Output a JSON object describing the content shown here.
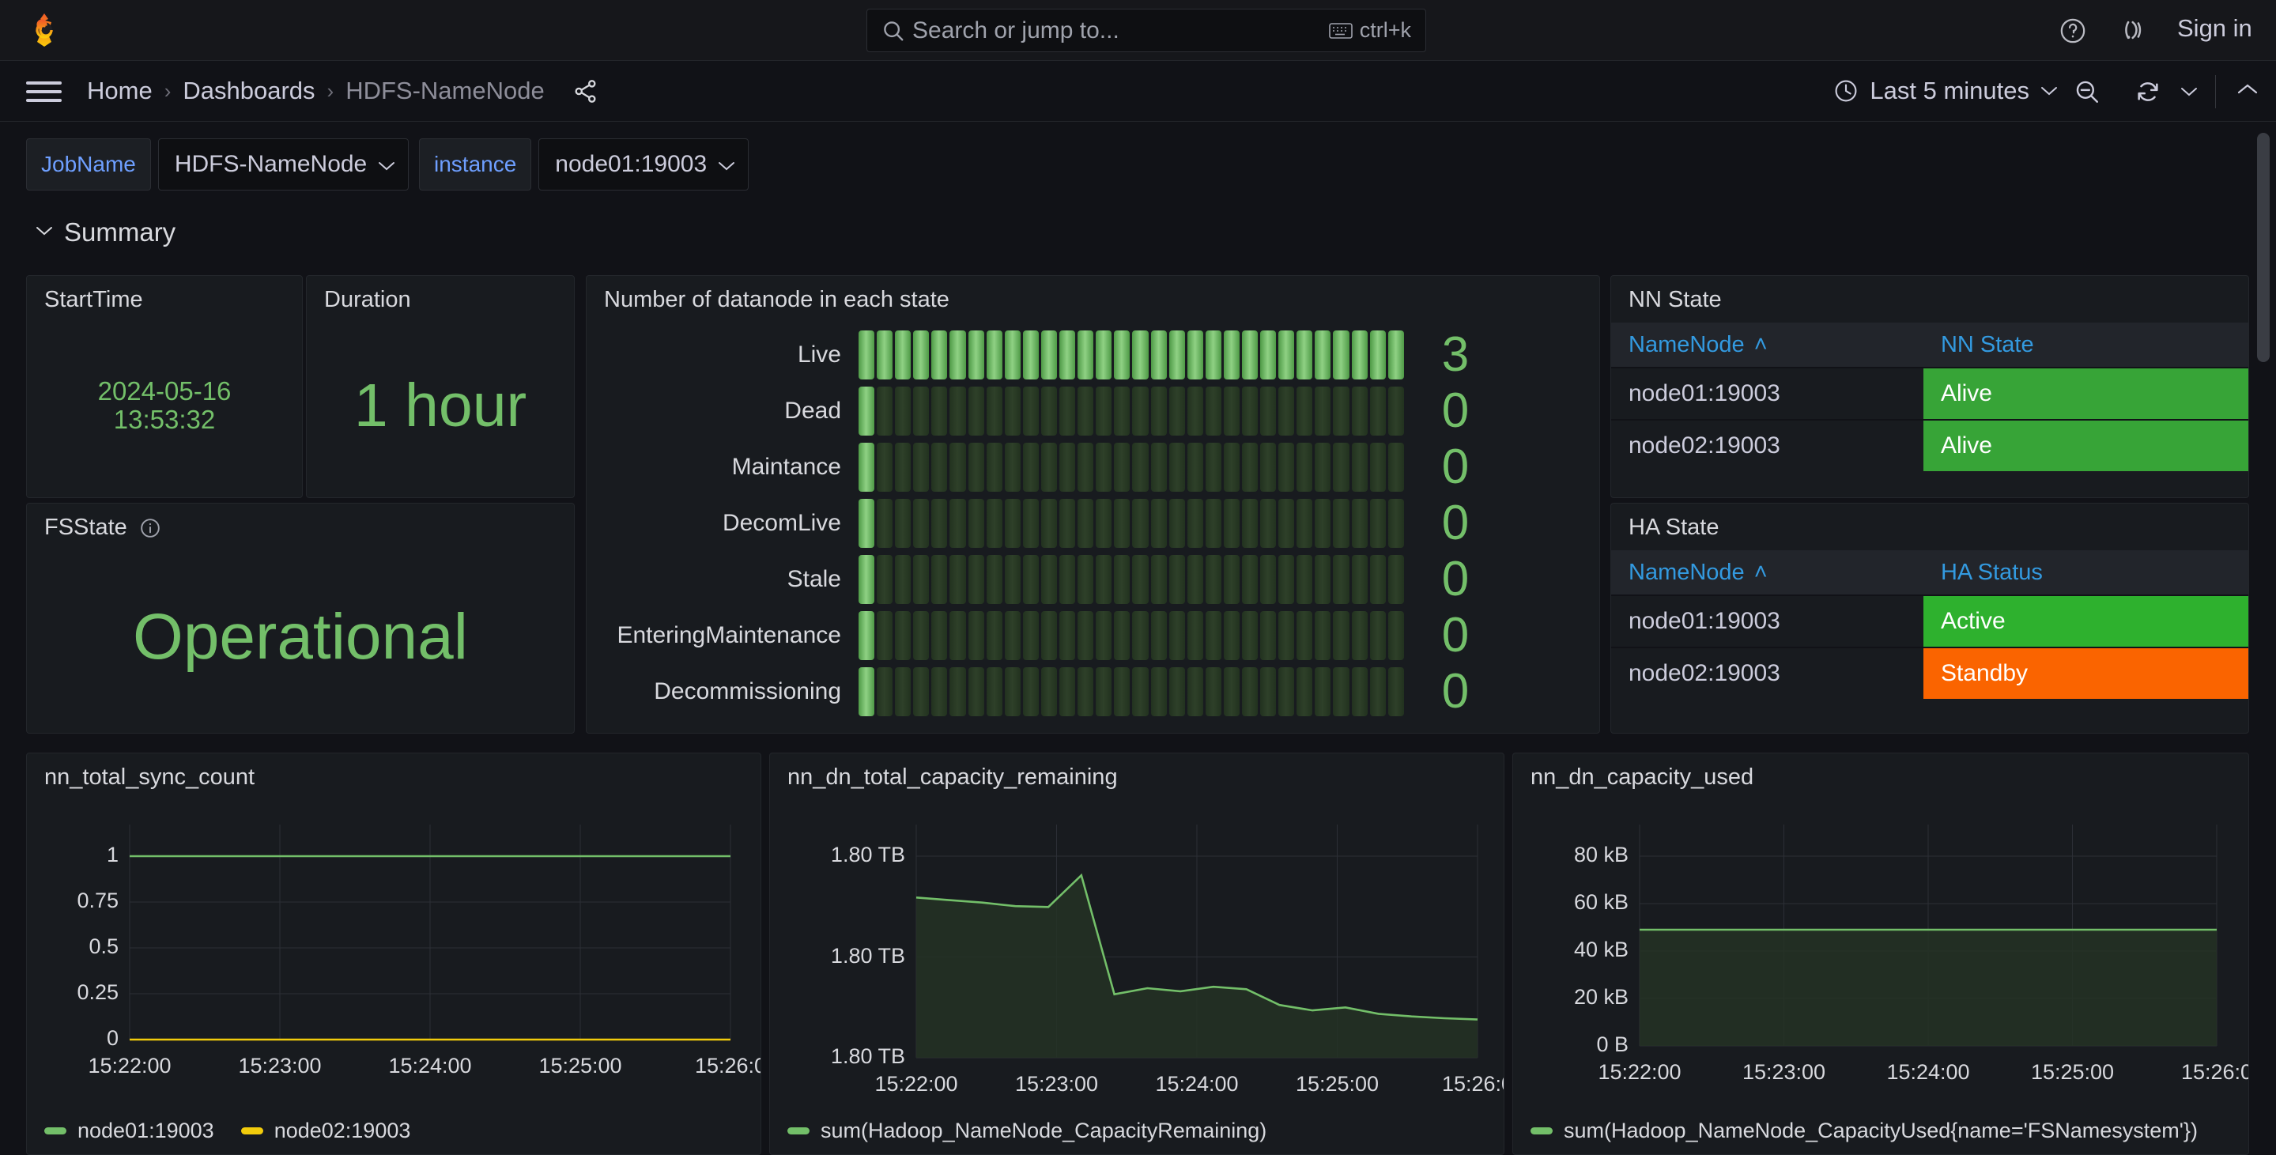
{
  "topnav": {
    "logo_name": "grafana-logo",
    "search": {
      "placeholder": "Search or jump to...",
      "shortcut": "ctrl+k"
    },
    "signin_label": "Sign in"
  },
  "breadcrumb": {
    "items": [
      "Home",
      "Dashboards",
      "HDFS-NameNode"
    ],
    "separator": "›"
  },
  "toolbar": {
    "time_range": "Last 5 minutes"
  },
  "variables": [
    {
      "label": "JobName",
      "value": "HDFS-NameNode"
    },
    {
      "label": "instance",
      "value": "node01:19003"
    }
  ],
  "row": {
    "title": "Summary"
  },
  "panels": {
    "starttime": {
      "title": "StartTime",
      "value_line1": "2024-05-16",
      "value_line2": "13:53:32"
    },
    "duration": {
      "title": "Duration",
      "value": "1 hour"
    },
    "fsstate": {
      "title": "FSState",
      "value": "Operational"
    },
    "datanode": {
      "title": "Number of datanode in each state",
      "total_cells": 30,
      "rows": [
        {
          "label": "Live",
          "value": "3",
          "lit": 30
        },
        {
          "label": "Dead",
          "value": "0",
          "lit": 1
        },
        {
          "label": "Maintance",
          "value": "0",
          "lit": 1
        },
        {
          "label": "DecomLive",
          "value": "0",
          "lit": 1
        },
        {
          "label": "Stale",
          "value": "0",
          "lit": 1
        },
        {
          "label": "EnteringMaintenance",
          "value": "0",
          "lit": 1
        },
        {
          "label": "Decommissioning",
          "value": "0",
          "lit": 1
        }
      ]
    },
    "nn_state": {
      "title": "NN State",
      "columns": [
        "NameNode",
        "NN State"
      ],
      "sort_indicator": "˄",
      "rows": [
        {
          "name": "node01:19003",
          "status": "Alive",
          "color": "#37a437"
        },
        {
          "name": "node02:19003",
          "status": "Alive",
          "color": "#37a437"
        }
      ]
    },
    "ha_state": {
      "title": "HA State",
      "columns": [
        "NameNode",
        "HA Status"
      ],
      "sort_indicator": "˄",
      "rows": [
        {
          "name": "node01:19003",
          "status": "Active",
          "color": "#2eb12e"
        },
        {
          "name": "node02:19003",
          "status": "Standby",
          "color": "#fa6400"
        }
      ]
    }
  },
  "chart_data": [
    {
      "type": "line",
      "panel": "nn_total_sync_count",
      "title": "nn_total_sync_count",
      "xlabel": "",
      "ylabel": "",
      "grid": true,
      "legend_position": "bottom",
      "ytick_labels": [
        "1",
        "0.75",
        "0.5",
        "0.25",
        "0"
      ],
      "ylim": [
        0,
        1
      ],
      "xtick_labels": [
        "15:22:00",
        "15:23:00",
        "15:24:00",
        "15:25:00",
        "15:26:0"
      ],
      "series": [
        {
          "name": "node01:19003",
          "color": "#73bf69",
          "values": [
            1,
            1,
            1,
            1,
            1,
            1,
            1,
            1,
            1,
            1,
            1,
            1,
            1,
            1,
            1,
            1,
            1,
            1,
            1,
            1,
            1
          ]
        },
        {
          "name": "node02:19003",
          "color": "#f2cc0c",
          "values": [
            0,
            0,
            0,
            0,
            0,
            0,
            0,
            0,
            0,
            0,
            0,
            0,
            0,
            0,
            0,
            0,
            0,
            0,
            0,
            0,
            0
          ]
        }
      ]
    },
    {
      "type": "area",
      "panel": "nn_dn_total_capacity_remaining",
      "title": "nn_dn_total_capacity_remaining",
      "xlabel": "",
      "ylabel": "",
      "grid": true,
      "legend_position": "bottom",
      "ytick_labels": [
        "1.80 TB",
        "1.80 TB",
        "1.80 TB"
      ],
      "xtick_labels": [
        "15:22:00",
        "15:23:00",
        "15:24:00",
        "15:25:00",
        "15:26:0"
      ],
      "series": [
        {
          "name": "sum(Hadoop_NameNode_CapacityRemaining)",
          "color": "#73bf69",
          "values": [
            0.795,
            0.782,
            0.77,
            0.752,
            0.748,
            0.905,
            0.315,
            0.345,
            0.33,
            0.352,
            0.34,
            0.262,
            0.235,
            0.25,
            0.218,
            0.205,
            0.196,
            0.19
          ]
        }
      ]
    },
    {
      "type": "area",
      "panel": "nn_dn_capacity_used",
      "title": "nn_dn_capacity_used",
      "xlabel": "",
      "ylabel": "",
      "grid": true,
      "legend_position": "bottom",
      "ytick_labels": [
        "80 kB",
        "60 kB",
        "40 kB",
        "20 kB",
        "0 B"
      ],
      "ylim": [
        0,
        80
      ],
      "xtick_labels": [
        "15:22:00",
        "15:23:00",
        "15:24:00",
        "15:25:00",
        "15:26:0"
      ],
      "series": [
        {
          "name": "sum(Hadoop_NameNode_CapacityUsed{name='FSNamesystem'})",
          "color": "#73bf69",
          "values": [
            49,
            49,
            49,
            49,
            49,
            49,
            49,
            49,
            49,
            49,
            49,
            49,
            49,
            49,
            49,
            49,
            49,
            49,
            49,
            49,
            49
          ]
        }
      ]
    }
  ]
}
